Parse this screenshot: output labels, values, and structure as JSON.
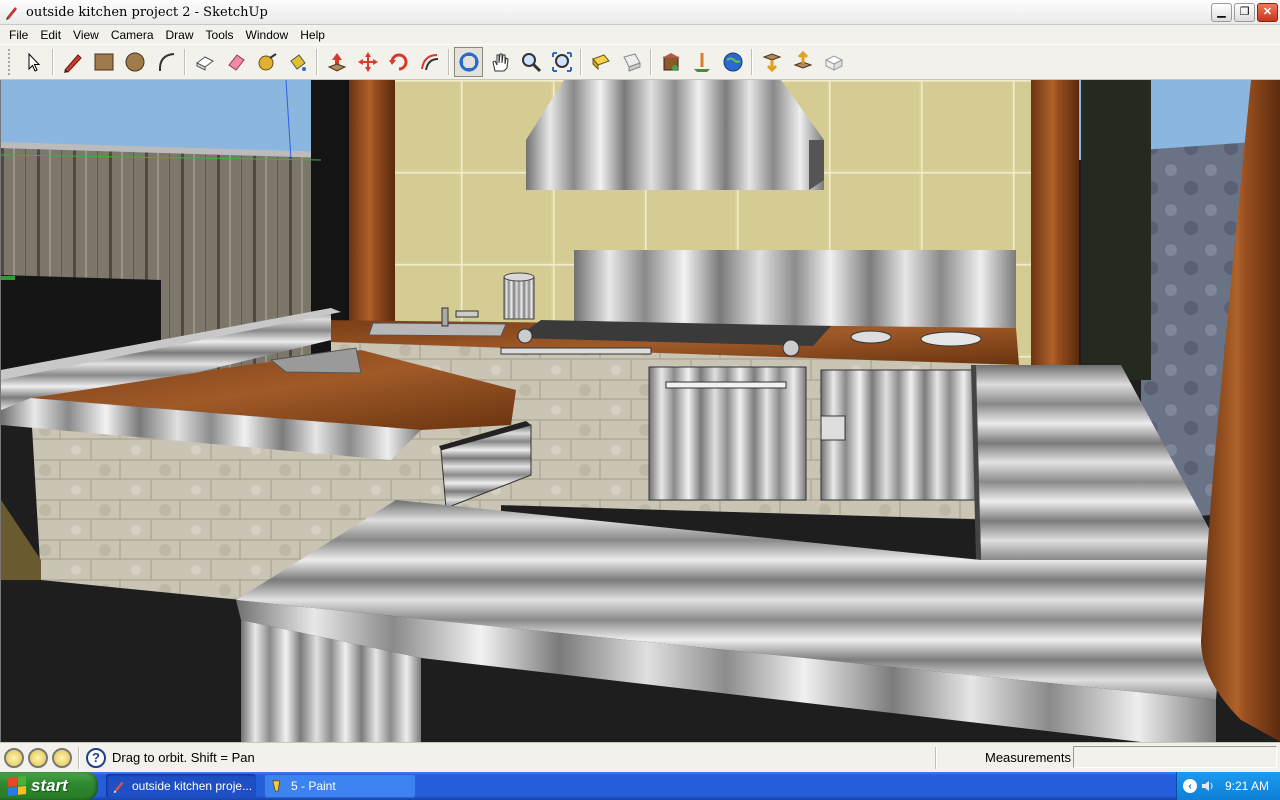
{
  "window": {
    "title": "outside kitchen project 2 - SketchUp",
    "controls": {
      "minimize": "▁",
      "restore": "❐",
      "close": "✕"
    }
  },
  "menu": [
    {
      "label": "File"
    },
    {
      "label": "Edit"
    },
    {
      "label": "View"
    },
    {
      "label": "Camera"
    },
    {
      "label": "Draw"
    },
    {
      "label": "Tools"
    },
    {
      "label": "Window"
    },
    {
      "label": "Help"
    }
  ],
  "toolbar": {
    "groups": [
      [
        "select-icon"
      ],
      [
        "pencil-icon",
        "rectangle-icon",
        "circle-icon",
        "arc-icon"
      ],
      [
        "make-component-icon",
        "eraser-icon",
        "tape-measure-icon",
        "paint-bucket-icon"
      ],
      [
        "push-pull-icon",
        "move-icon",
        "rotate-icon",
        "offset-icon"
      ],
      [
        "orbit-icon",
        "pan-icon",
        "zoom-icon",
        "zoom-extents-icon"
      ],
      [
        "previous-view-icon",
        "next-view-icon"
      ],
      [
        "warehouse-icon",
        "add-location-icon",
        "google-earth-icon"
      ],
      [
        "get-models-icon",
        "share-model-icon",
        "share-component-icon"
      ]
    ],
    "active_tool": "orbit-icon"
  },
  "statusbar": {
    "icons": [
      "geo-location-icon",
      "credits-icon",
      "instructor-icon"
    ],
    "help_icon_glyph": "?",
    "message": "Drag to orbit.  Shift = Pan",
    "measurements_label": "Measurements",
    "measurements_value": ""
  },
  "taskbar": {
    "start_label": "start",
    "tasks": [
      {
        "label": "outside kitchen proje...",
        "active": true
      },
      {
        "label": "5 - Paint",
        "active": false
      }
    ],
    "tray_chevron": "‹",
    "clock": "9:21 AM"
  },
  "colors": {
    "wood": "#8a4a22",
    "countertop": "#8e5020",
    "stainless": "#c8c8c8",
    "backsplash_tile": "#d8d19a",
    "floor": "#1e1e1e",
    "sky": "#8ab6e0",
    "taskbar_blue": "#245edb",
    "start_green": "#2f8a2f"
  }
}
